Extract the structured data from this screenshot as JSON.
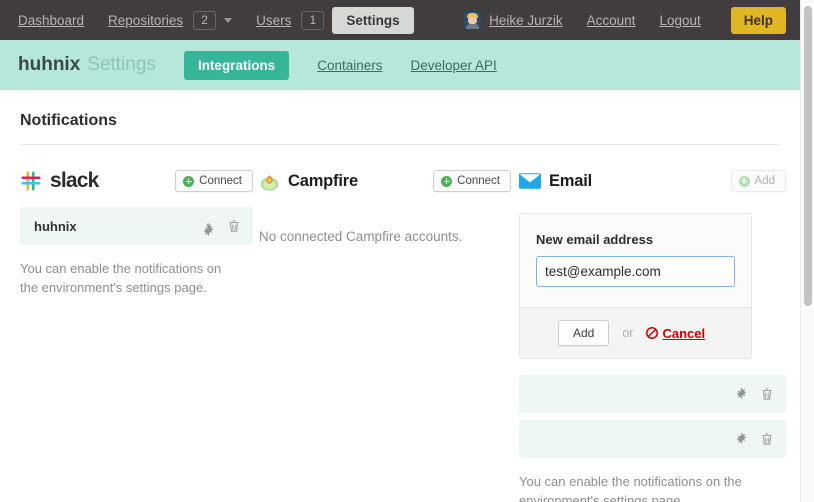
{
  "topnav": {
    "dashboard": "Dashboard",
    "repositories": "Repositories",
    "repositories_count": "2",
    "users": "Users",
    "users_count": "1",
    "settings_tab": "Settings",
    "user_name": "Heike Jurzik",
    "account": "Account",
    "logout": "Logout",
    "help": "Help",
    "bg_color": "#413c3e",
    "help_color": "#e0b625"
  },
  "subnav": {
    "brand": "huhnix",
    "brand_suffix": "Settings",
    "tab_integrations": "Integrations",
    "tab_containers": "Containers",
    "tab_developer_api": "Developer API",
    "bg_color": "#b5e8da",
    "active_color": "#35b699"
  },
  "page": {
    "title": "Notifications"
  },
  "slack": {
    "name": "slack",
    "connect_label": "Connect",
    "accounts": [
      {
        "name": "huhnix"
      }
    ],
    "note": "You can enable the notifications on the environment's settings page."
  },
  "campfire": {
    "name": "Campfire",
    "connect_label": "Connect",
    "empty_text": "No connected Campfire accounts."
  },
  "email": {
    "name": "Email",
    "add_label": "Add",
    "form": {
      "label": "New email address",
      "value": "test@example.com",
      "placeholder": "",
      "submit_label": "Add",
      "or_label": "or",
      "cancel_label": "Cancel"
    },
    "addresses": [
      {
        "name": "",
        "redacted": true
      },
      {
        "name": "",
        "redacted": true
      }
    ],
    "note": "You can enable the notifications on the environment's settings page."
  },
  "icons": {
    "slack": "slack-logo-icon",
    "campfire": "campfire-logo-icon",
    "email": "envelope-icon",
    "gear": "gear-icon",
    "trash": "trash-icon",
    "plus": "plus-circle-icon",
    "cancel": "no-entry-icon",
    "caret": "chevron-down-icon"
  }
}
